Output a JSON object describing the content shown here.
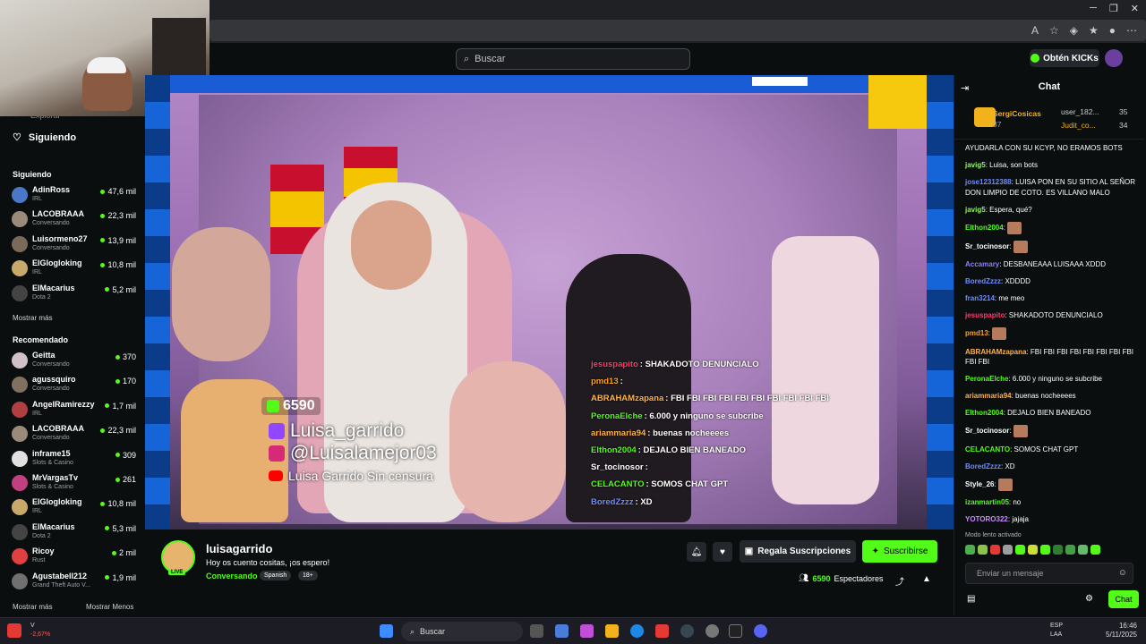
{
  "header": {
    "search_placeholder": "Buscar",
    "kicks_button": "Obtén KICKs"
  },
  "sidebar": {
    "top_item_partial": "Explorar",
    "following_link": "Siguiendo",
    "following_heading": "Siguiendo",
    "following": [
      {
        "name": "AdinRoss",
        "category": "IRL",
        "viewers": "47,6 mil",
        "color": "#4a78c8"
      },
      {
        "name": "LACOBRAAA",
        "category": "Conversando",
        "viewers": "22,3 mil",
        "color": "#9a8a7a"
      },
      {
        "name": "Luisormeno27",
        "category": "Conversando",
        "viewers": "13,9 mil",
        "color": "#7a6a5a"
      },
      {
        "name": "ElGlogloking",
        "category": "IRL",
        "viewers": "10,8 mil",
        "color": "#c9a96a"
      },
      {
        "name": "ElMacarius",
        "category": "Dota 2",
        "viewers": "5,2 mil",
        "color": "#444"
      }
    ],
    "show_more_1": "Mostrar más",
    "recommended_heading": "Recomendado",
    "recommended": [
      {
        "name": "Geitta",
        "category": "Conversando",
        "viewers": "370",
        "color": "#d0c0c8"
      },
      {
        "name": "agussquiro",
        "category": "Conversando",
        "viewers": "170",
        "color": "#807060"
      },
      {
        "name": "AngelRamirezzy",
        "category": "IRL",
        "viewers": "1,7 mil",
        "color": "#b04040"
      },
      {
        "name": "LACOBRAAA",
        "category": "Conversando",
        "viewers": "22,3 mil",
        "color": "#9a8a7a"
      },
      {
        "name": "inframe15",
        "category": "Slots & Casino",
        "viewers": "309",
        "color": "#e0e0e0"
      },
      {
        "name": "MrVargasTv",
        "category": "Slots & Casino",
        "viewers": "261",
        "color": "#c04080"
      },
      {
        "name": "ElGlogloking",
        "category": "IRL",
        "viewers": "10,8 mil",
        "color": "#c9a96a"
      },
      {
        "name": "ElMacarius",
        "category": "Dota 2",
        "viewers": "5,3 mil",
        "color": "#444"
      },
      {
        "name": "Ricoy",
        "category": "Rust",
        "viewers": "2 mil",
        "color": "#e04040"
      },
      {
        "name": "Agustabell212",
        "category": "Grand Theft Auto V...",
        "viewers": "1,9 mil",
        "color": "#707070"
      }
    ],
    "show_more_2": "Mostrar más",
    "show_less": "Mostrar Menos"
  },
  "video_overlay": {
    "count": "6590",
    "social_handle_1": "Luisa_garrido",
    "social_handle_2": "@Luisalamejor03",
    "youtube_label": "Luisa Garrido Sin censura",
    "chat": [
      {
        "user": "jesuspapito",
        "text": "SHAKADOTO DENUNCIALO",
        "color": "#ff3b6b"
      },
      {
        "user": "pmd13",
        "text": "",
        "color": "#ff9f1a"
      },
      {
        "user": "ABRAHAMzapana",
        "text": "FBI FBI FBI FBI FBI FBI FBI FBI FBI FBI",
        "color": "#ffb347"
      },
      {
        "user": "PeronaElche",
        "text": "6.000 y ninguno se subcribe",
        "color": "#53fc18"
      },
      {
        "user": "ariammaria94",
        "text": "buenas nocheeees",
        "color": "#ffb347"
      },
      {
        "user": "Elthon2004",
        "text": "DEJALO BIEN BANEADO",
        "color": "#53fc18"
      },
      {
        "user": "Sr_tocinosor",
        "text": "",
        "color": "#ffffff"
      },
      {
        "user": "CELACANTO",
        "text": "SOMOS CHAT GPT",
        "color": "#53fc18"
      },
      {
        "user": "BoredZzzz",
        "text": "XD",
        "color": "#6f8cff"
      }
    ]
  },
  "stream_info": {
    "live_badge": "LIVE",
    "streamer": "luisagarrido",
    "title": "Hoy os cuento cositas, ¡os espero!",
    "category": "Conversando",
    "tags": [
      "Spanish",
      "18+"
    ],
    "gift_button": "Regala Suscripciones",
    "subscribe_button": "Suscribirse",
    "viewer_count": "6590",
    "viewer_label": "Espectadores"
  },
  "chat": {
    "title": "Chat",
    "top_gifters": [
      {
        "name": "SergiCosicas",
        "count": "37"
      },
      {
        "name": "user_182...",
        "count": "35"
      },
      {
        "name": "Judit_co...",
        "count": "34"
      }
    ],
    "messages": [
      {
        "user": "",
        "text": "AYUDARLA CON SU KCYP, NO ERAMOS BOTS",
        "color": "#ffffff"
      },
      {
        "user": "javig5",
        "text": "Luisa, son bots",
        "color": "#8cff5a"
      },
      {
        "user": "jose12312388",
        "text": "LUISA PON EN SU SITIO AL SEÑOR DON LIMPIO DE COTO. ES VILLANO MALO",
        "color": "#6f8cff"
      },
      {
        "user": "javig5",
        "text": "Espera, qué?",
        "color": "#8cff5a"
      },
      {
        "user": "Elthon2004",
        "text": "",
        "color": "#53fc18",
        "emote": true
      },
      {
        "user": "Sr_tocinosor",
        "text": "",
        "color": "#ffffff",
        "emote": true
      },
      {
        "user": "Accamary",
        "text": "DESBANEAAA LUISAAA XDDD",
        "color": "#8a7dff"
      },
      {
        "user": "BoredZzzz",
        "text": "XDDDD",
        "color": "#6f8cff"
      },
      {
        "user": "fran3214",
        "text": "me meo",
        "color": "#6f8cff"
      },
      {
        "user": "jesuspapito",
        "text": "SHAKADOTO DENUNCIALO",
        "color": "#ff3b6b"
      },
      {
        "user": "pmd13",
        "text": "",
        "color": "#ff9f1a",
        "emote": true
      },
      {
        "user": "ABRAHAMzapana",
        "text": "FBI FBI FBI FBI FBI FBI FBI FBI FBI FBI",
        "color": "#ffb347"
      },
      {
        "user": "PeronaElche",
        "text": "6.000 y ninguno se subcribe",
        "color": "#53fc18"
      },
      {
        "user": "ariammaria94",
        "text": "buenas nocheeees",
        "color": "#ffb347"
      },
      {
        "user": "Elthon2004",
        "text": "DEJALO BIEN BANEADO",
        "color": "#53fc18"
      },
      {
        "user": "Sr_tocinosor",
        "text": "",
        "color": "#ffffff",
        "emote": true
      },
      {
        "user": "CELACANTO",
        "text": "SOMOS CHAT GPT",
        "color": "#53fc18"
      },
      {
        "user": "BoredZzzz",
        "text": "XD",
        "color": "#6f8cff"
      },
      {
        "user": "Style_26",
        "text": "",
        "color": "#ffffff",
        "emote": true
      },
      {
        "user": "izanmartin05",
        "text": "no",
        "color": "#53fc18"
      },
      {
        "user": "YOTORO322",
        "text": "jajaja",
        "color": "#c88cff"
      }
    ],
    "slow_mode": "Modo lento activado",
    "input_placeholder": "Enviar un mensaje",
    "send_button": "Chat"
  },
  "taskbar": {
    "search": "Buscar",
    "stock_change": "-2,67%",
    "lang_line1": "ESP",
    "lang_line2": "LAA",
    "time": "16:46",
    "date": "5/11/2025"
  }
}
